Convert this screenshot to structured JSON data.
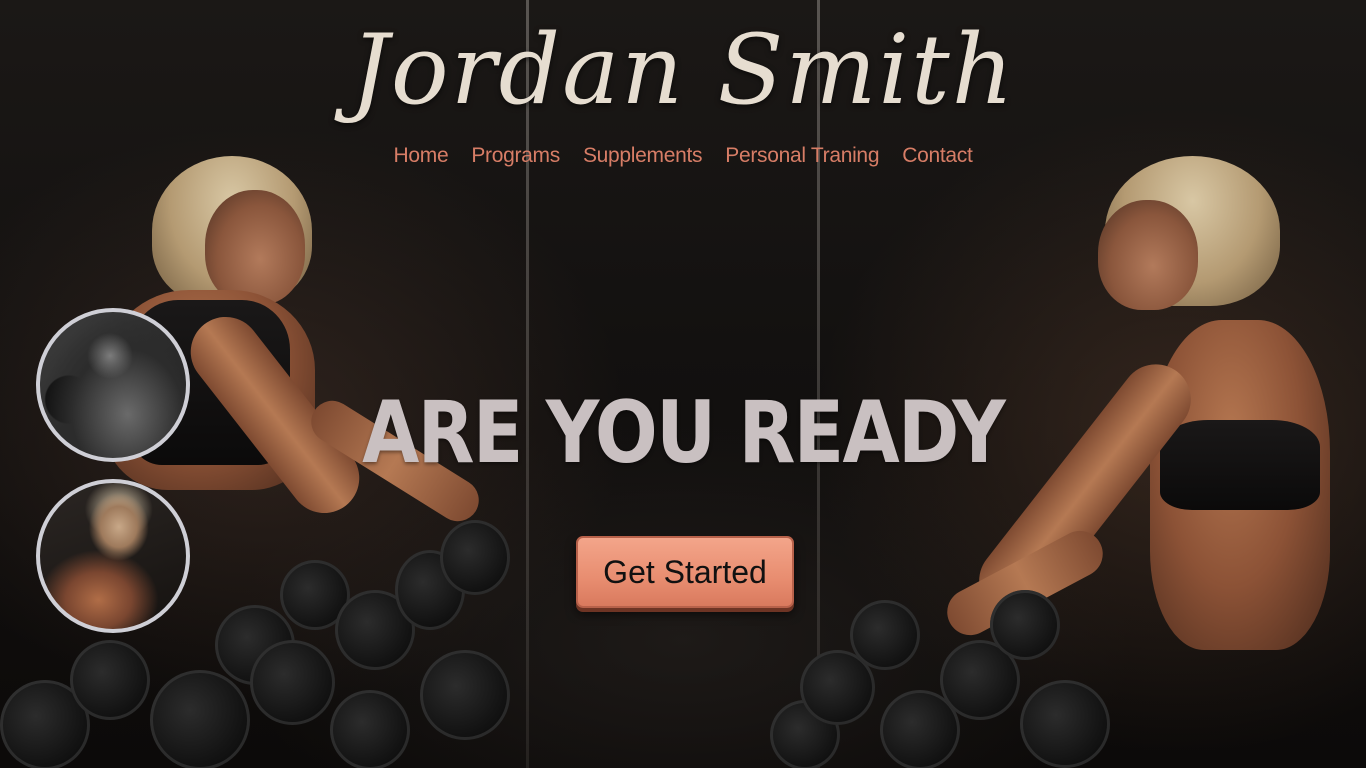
{
  "brand": {
    "name": "Jordan Smith"
  },
  "nav": {
    "items": [
      {
        "label": "Home"
      },
      {
        "label": "Programs"
      },
      {
        "label": "Supplements"
      },
      {
        "label": "Personal Traning"
      },
      {
        "label": "Contact"
      }
    ]
  },
  "hero": {
    "title": "ARE YOU READY",
    "cta_label": "Get Started"
  },
  "thumbnails": [
    {
      "icon": "male-bodybuilder-photo"
    },
    {
      "icon": "female-athlete-photo"
    }
  ],
  "colors": {
    "nav_link": "#d77d66",
    "brand_text": "#e6ddd0",
    "hero_text": "#c9c0c1",
    "cta_bg": "#e88d70",
    "thumb_border": "#cfcfd6"
  }
}
